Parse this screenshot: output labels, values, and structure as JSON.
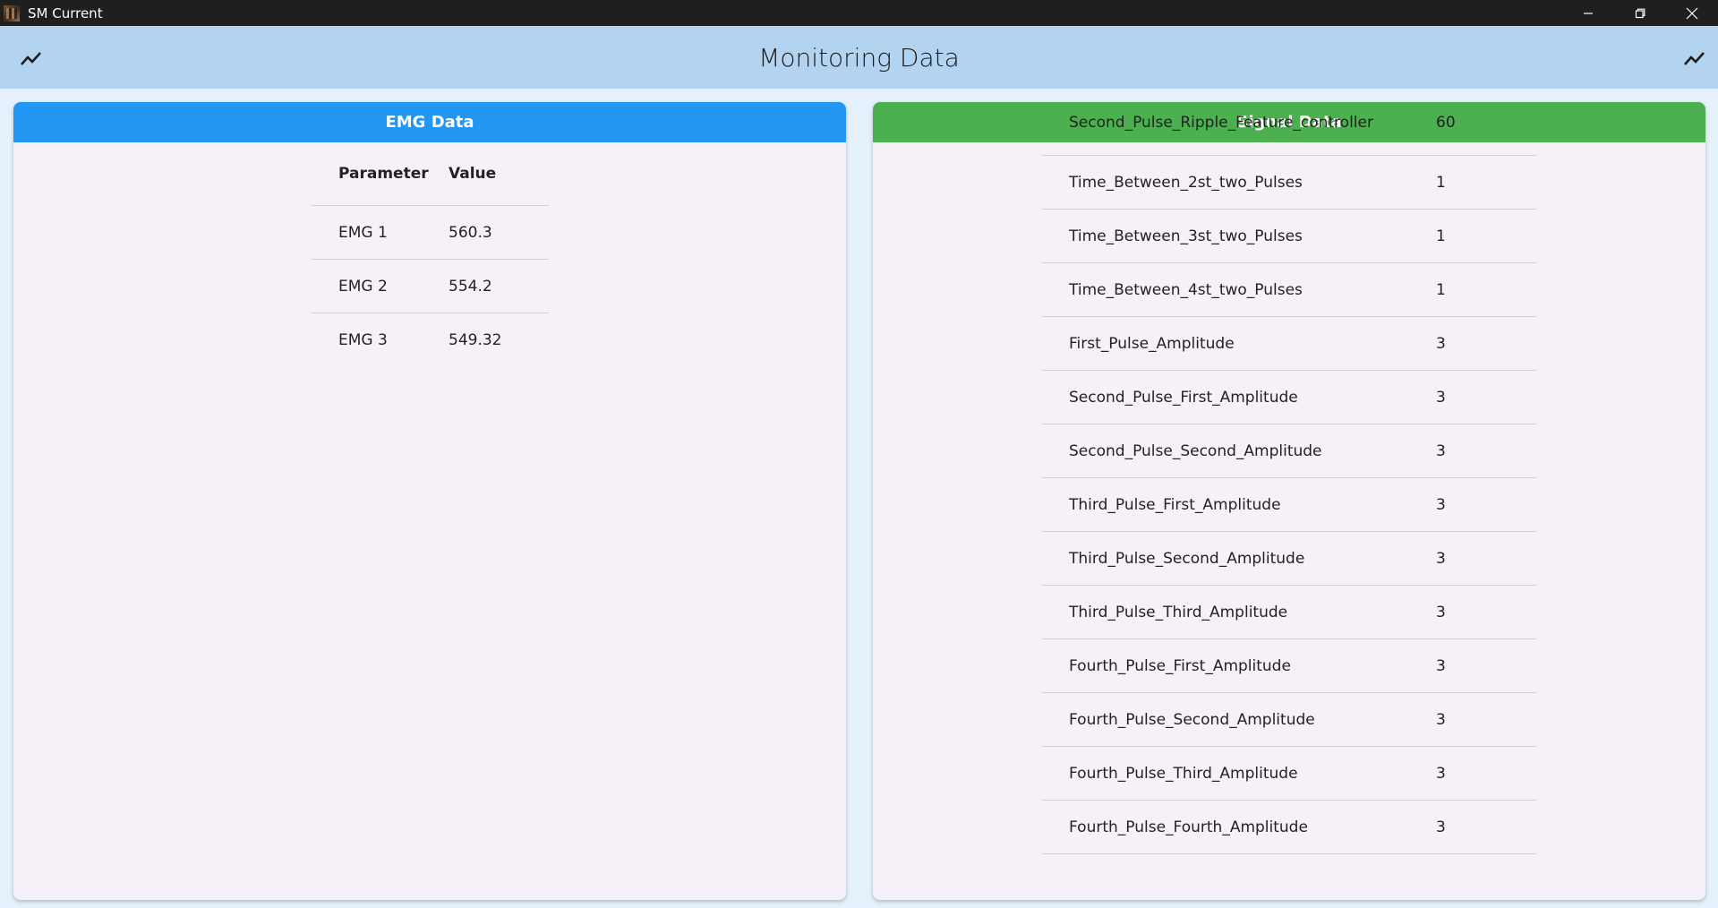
{
  "window": {
    "title": "SM Current"
  },
  "appbar": {
    "title": "Monitoring Data",
    "left_icon": "trending-up-icon",
    "right_icon": "trending-up-icon"
  },
  "emg_card": {
    "title": "EMG Data",
    "header_color": "#2196f3",
    "columns": [
      "Parameter",
      "Value"
    ],
    "rows": [
      {
        "parameter": "EMG 1",
        "value": "560.3"
      },
      {
        "parameter": "EMG 2",
        "value": "554.2"
      },
      {
        "parameter": "EMG 3",
        "value": "549.32"
      }
    ]
  },
  "signal_card": {
    "title": "Signal Data",
    "header_color": "#4caf50",
    "rows": [
      {
        "parameter": "Second_Pulse_Ripple_Feature_controller",
        "value": "60"
      },
      {
        "parameter": "Time_Between_2st_two_Pulses",
        "value": "1"
      },
      {
        "parameter": "Time_Between_3st_two_Pulses",
        "value": "1"
      },
      {
        "parameter": "Time_Between_4st_two_Pulses",
        "value": "1"
      },
      {
        "parameter": "First_Pulse_Amplitude",
        "value": "3"
      },
      {
        "parameter": "Second_Pulse_First_Amplitude",
        "value": "3"
      },
      {
        "parameter": "Second_Pulse_Second_Amplitude",
        "value": "3"
      },
      {
        "parameter": "Third_Pulse_First_Amplitude",
        "value": "3"
      },
      {
        "parameter": "Third_Pulse_Second_Amplitude",
        "value": "3"
      },
      {
        "parameter": "Third_Pulse_Third_Amplitude",
        "value": "3"
      },
      {
        "parameter": "Fourth_Pulse_First_Amplitude",
        "value": "3"
      },
      {
        "parameter": "Fourth_Pulse_Second_Amplitude",
        "value": "3"
      },
      {
        "parameter": "Fourth_Pulse_Third_Amplitude",
        "value": "3"
      },
      {
        "parameter": "Fourth_Pulse_Fourth_Amplitude",
        "value": "3"
      }
    ]
  }
}
